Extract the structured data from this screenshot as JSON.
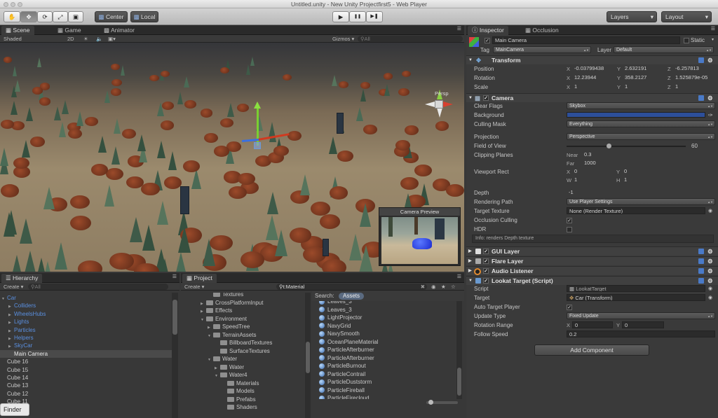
{
  "window": {
    "title": "Untitled.unity - New Unity Projectfirst5 - Web Player"
  },
  "toolbar": {
    "tools": [
      "hand-icon",
      "move-icon",
      "rotate-icon",
      "scale-icon",
      "rect-icon"
    ],
    "pivot": "Center",
    "space": "Local",
    "play_icons": [
      "▶",
      "❚❚",
      "▶❚"
    ],
    "layers": "Layers",
    "layout": "Layout"
  },
  "scene_panel": {
    "tabs": [
      "Scene",
      "Game",
      "Animator"
    ],
    "shading": "Shaded",
    "mode2d": "2D",
    "gizmos": "Gizmos",
    "search_placeholder": "All",
    "persp": "Persp",
    "camera_preview": "Camera Preview"
  },
  "hierarchy": {
    "tab": "Hierarchy",
    "create": "Create",
    "search_placeholder": "All",
    "items": [
      {
        "label": "Car",
        "indent": 0,
        "arrow": "▼",
        "color": "#5a8fdf"
      },
      {
        "label": "Colliders",
        "indent": 1,
        "arrow": "▶",
        "color": "#5a8fdf"
      },
      {
        "label": "WheelsHubs",
        "indent": 1,
        "arrow": "▶",
        "color": "#5a8fdf"
      },
      {
        "label": "Lights",
        "indent": 1,
        "arrow": "▶",
        "color": "#5a8fdf"
      },
      {
        "label": "Particles",
        "indent": 1,
        "arrow": "▶",
        "color": "#5a8fdf"
      },
      {
        "label": "Helpers",
        "indent": 1,
        "arrow": "▶",
        "color": "#5a8fdf"
      },
      {
        "label": "SkyCar",
        "indent": 1,
        "arrow": "▶",
        "color": "#5a8fdf"
      },
      {
        "label": "Main Camera",
        "indent": 1,
        "arrow": "",
        "color": "#e8e8e8",
        "selected": true
      },
      {
        "label": "Cube 16",
        "indent": 0,
        "arrow": "",
        "color": "#c8c8c8"
      },
      {
        "label": "Cube 15",
        "indent": 0,
        "arrow": "",
        "color": "#c8c8c8"
      },
      {
        "label": "Cube 14",
        "indent": 0,
        "arrow": "",
        "color": "#c8c8c8"
      },
      {
        "label": "Cube 13",
        "indent": 0,
        "arrow": "",
        "color": "#c8c8c8"
      },
      {
        "label": "Cube 12",
        "indent": 0,
        "arrow": "",
        "color": "#c8c8c8"
      },
      {
        "label": "Cube 11",
        "indent": 0,
        "arrow": "",
        "color": "#c8c8c8"
      }
    ]
  },
  "project": {
    "tab": "Project",
    "create": "Create",
    "search_value": "t:Material",
    "search_label": "Search:",
    "assets_chip": "Assets",
    "folders": [
      {
        "label": "Textures",
        "indent": 2,
        "arrow": ""
      },
      {
        "label": "CrossPlatformInput",
        "indent": 1,
        "arrow": "▶"
      },
      {
        "label": "Effects",
        "indent": 1,
        "arrow": "▶"
      },
      {
        "label": "Environment",
        "indent": 1,
        "arrow": "▼"
      },
      {
        "label": "SpeedTree",
        "indent": 2,
        "arrow": "▶"
      },
      {
        "label": "TerrainAssets",
        "indent": 2,
        "arrow": "▼"
      },
      {
        "label": "BillboardTextures",
        "indent": 3,
        "arrow": ""
      },
      {
        "label": "SurfaceTextures",
        "indent": 3,
        "arrow": ""
      },
      {
        "label": "Water",
        "indent": 2,
        "arrow": "▼"
      },
      {
        "label": "Water",
        "indent": 3,
        "arrow": "▶"
      },
      {
        "label": "Water4",
        "indent": 3,
        "arrow": "▼"
      },
      {
        "label": "Materials",
        "indent": 4,
        "arrow": ""
      },
      {
        "label": "Models",
        "indent": 4,
        "arrow": ""
      },
      {
        "label": "Prefabs",
        "indent": 4,
        "arrow": ""
      },
      {
        "label": "Shaders",
        "indent": 4,
        "arrow": ""
      }
    ],
    "assets": [
      "Leaves_3",
      "Leaves_3",
      "LightProjector",
      "NavyGrid",
      "NavySmooth",
      "OceanPlaneMaterial",
      "ParticleAfterburner",
      "ParticleAfterburner",
      "ParticleBurnout",
      "ParticleContrail",
      "ParticleDuststorm",
      "ParticleFireball",
      "ParticleFirecloud"
    ]
  },
  "inspector": {
    "tabs": [
      "Inspector",
      "Occlusion"
    ],
    "object_name": "Main Camera",
    "static_label": "Static",
    "tag_label": "Tag",
    "tag_value": "MainCamera",
    "layer_label": "Layer",
    "layer_value": "Default",
    "transform": {
      "title": "Transform",
      "position": {
        "label": "Position",
        "x": "-0.03799438",
        "y": "2.632191",
        "z": "-6.257813"
      },
      "rotation": {
        "label": "Rotation",
        "x": "12.23944",
        "y": "358.2127",
        "z": "1.525879e-05"
      },
      "scale": {
        "label": "Scale",
        "x": "1",
        "y": "1",
        "z": "1"
      }
    },
    "camera": {
      "title": "Camera",
      "clear_flags": {
        "label": "Clear Flags",
        "value": "Skybox"
      },
      "background": {
        "label": "Background",
        "color": "#2d4f9a"
      },
      "culling_mask": {
        "label": "Culling Mask",
        "value": "Everything"
      },
      "projection": {
        "label": "Projection",
        "value": "Perspective"
      },
      "fov": {
        "label": "Field of View",
        "value": "60",
        "fraction": 0.35
      },
      "clipping": {
        "label": "Clipping Planes",
        "near_label": "Near",
        "near": "0.3",
        "far_label": "Far",
        "far": "1000"
      },
      "viewport": {
        "label": "Viewport Rect",
        "x": "0",
        "y": "0",
        "w": "1",
        "h": "1"
      },
      "depth": {
        "label": "Depth",
        "value": "-1"
      },
      "rendering_path": {
        "label": "Rendering Path",
        "value": "Use Player Settings"
      },
      "target_texture": {
        "label": "Target Texture",
        "value": "None (Render Texture)"
      },
      "occlusion_culling": {
        "label": "Occlusion Culling"
      },
      "hdr": {
        "label": "HDR"
      },
      "info": "Info: renders Depth texture"
    },
    "gui_layer": "GUI Layer",
    "flare_layer": "Flare Layer",
    "audio_listener": "Audio Listener",
    "lookat": {
      "title": "Lookat Target (Script)",
      "script": {
        "label": "Script",
        "value": "LookatTarget"
      },
      "target": {
        "label": "Target",
        "value": "Car (Transform)"
      },
      "auto_target": {
        "label": "Auto Target Player"
      },
      "update_type": {
        "label": "Update Type",
        "value": "Fixed Update"
      },
      "rotation_range": {
        "label": "Rotation Range",
        "x": "0",
        "y": "0"
      },
      "follow_speed": {
        "label": "Follow Speed",
        "value": "0.2"
      }
    },
    "add_component": "Add Component"
  },
  "finder_tooltip": "Finder"
}
